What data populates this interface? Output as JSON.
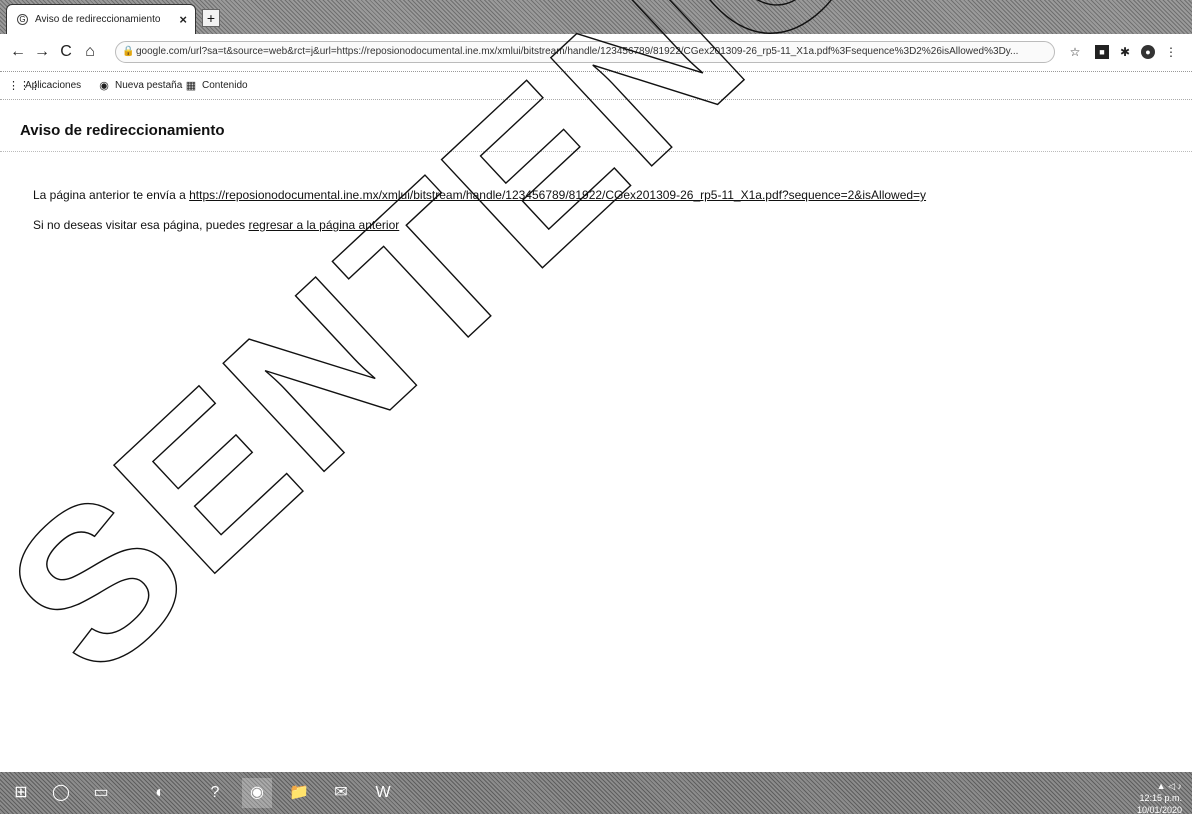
{
  "tab": {
    "title": "Aviso de redireccionamiento",
    "close": "×",
    "icon": "G"
  },
  "newtab": {
    "label": "+"
  },
  "toolbar": {
    "back": "←",
    "forward": "→",
    "reload": "C",
    "home": "⌂",
    "lock": "🔒",
    "url": "google.com/url?sa=t&source=web&rct=j&url=https://reposionodocumental.ine.mx/xmlui/bitstream/handle/123456789/81922/CGex201309-26_rp5-11_X1a.pdf%3Fsequence%3D2%26isAllowed%3Dy..."
  },
  "extensions": [
    "☆",
    "■",
    "✱",
    "●",
    "⋮"
  ],
  "bookmarks": [
    {
      "icon": "⋮⋮⋮",
      "label": "Aplicaciones"
    },
    {
      "icon": "◉",
      "label": "Nueva pestaña"
    },
    {
      "icon": "▦",
      "label": "Contenido"
    }
  ],
  "page": {
    "title": "Aviso de redireccionamiento",
    "line1_prefix": "La página anterior te envía a ",
    "line1_link": "https://reposionodocumental.ine.mx/xmlui/bitstream/handle/123456789/81922/CGex201309-26_rp5-11_X1a.pdf?sequence=2&isAllowed=y",
    "line2_prefix": "Si no deseas visitar esa página, puedes ",
    "line2_link": "regresar a la página anterior"
  },
  "watermark": {
    "text": "SENTENCIA"
  },
  "taskbar": {
    "items": [
      "⊞",
      "◯",
      "▭",
      "◐",
      "?",
      "◉",
      "📁",
      "✉",
      "W"
    ],
    "tray_icons": "▲ ◁ ♪",
    "time": "12:15 p.m.",
    "date": "10/01/2020"
  }
}
